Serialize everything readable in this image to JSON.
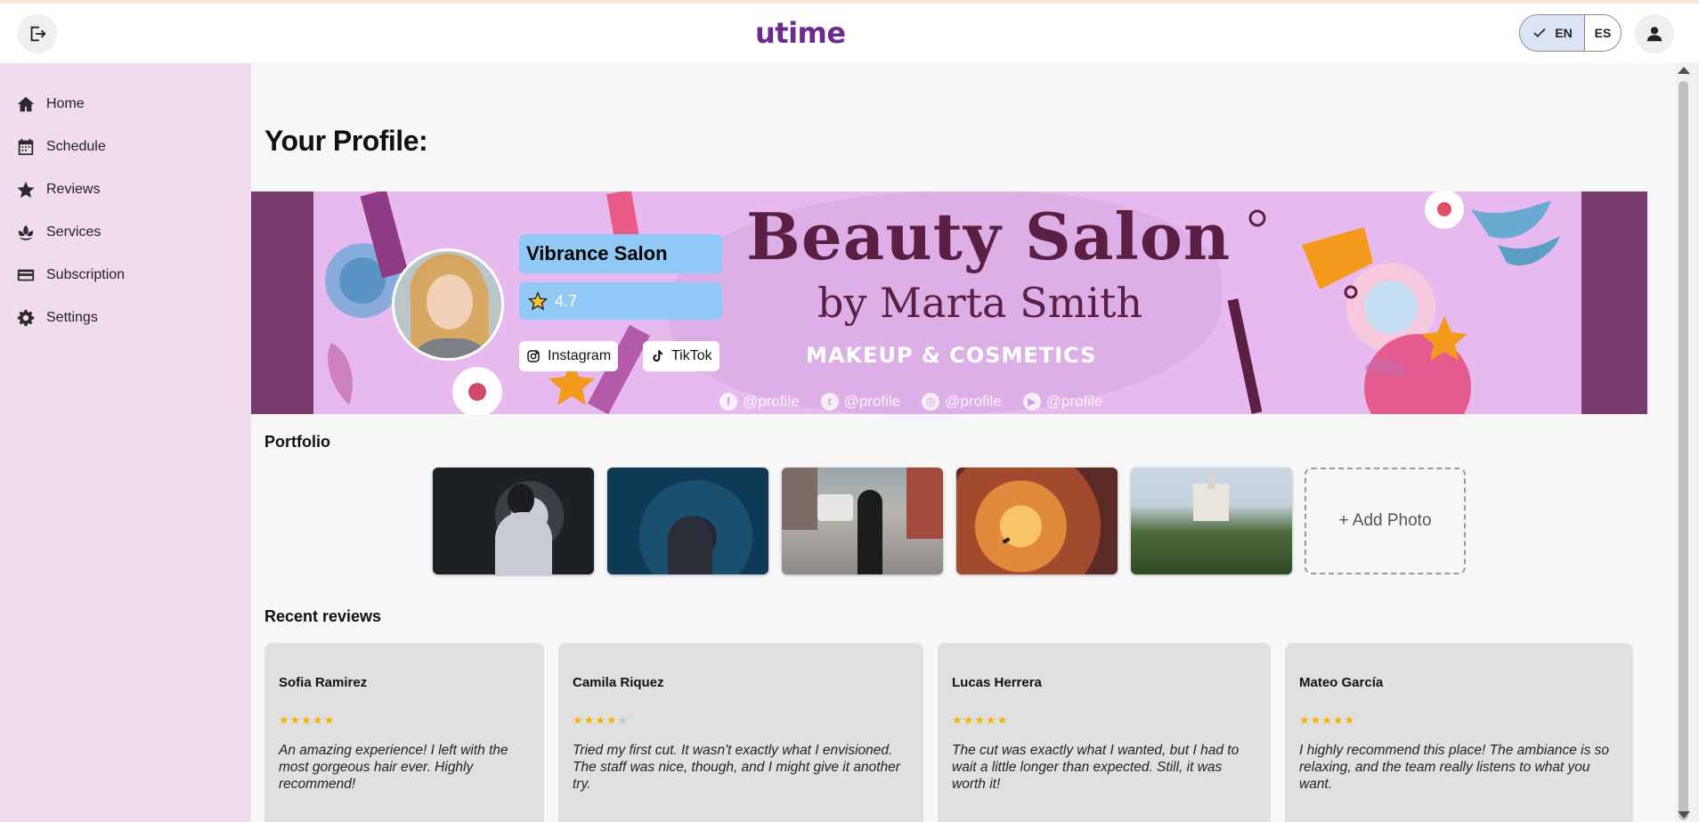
{
  "app": {
    "logo": "utime"
  },
  "header": {
    "lang_en": "EN",
    "lang_es": "ES"
  },
  "sidebar": {
    "items": [
      {
        "label": "Home",
        "icon": "home-icon"
      },
      {
        "label": "Schedule",
        "icon": "calendar-icon"
      },
      {
        "label": "Reviews",
        "icon": "star-icon"
      },
      {
        "label": "Services",
        "icon": "lotus-icon"
      },
      {
        "label": "Subscription",
        "icon": "card-icon"
      },
      {
        "label": "Settings",
        "icon": "gear-icon"
      }
    ]
  },
  "profile": {
    "page_title": "Your Profile:",
    "salon_name": "Vibrance Salon",
    "rating": "4.7",
    "links": {
      "instagram": "Instagram",
      "tiktok": "TikTok"
    },
    "banner": {
      "title": "Beauty Salon",
      "byline": "by Marta Smith",
      "subtitle": "MAKEUP & COSMETICS",
      "handles": [
        "@profile",
        "@profile",
        "@profile",
        "@profile"
      ]
    }
  },
  "portfolio": {
    "title": "Portfolio",
    "add_label": "+ Add Photo"
  },
  "reviews": {
    "title": "Recent reviews",
    "items": [
      {
        "name": "Sofia Ramirez",
        "stars": "★★★★★",
        "stars_off": "",
        "rating": 5,
        "text": "An amazing experience! I left with the most gorgeous hair ever. Highly recommend!"
      },
      {
        "name": "Camila Riquez",
        "stars": "★★★★",
        "stars_off": "★",
        "rating": 4,
        "text": "Tried my first cut. It wasn't exactly what I envisioned. The staff was nice, though, and I might give it another try."
      },
      {
        "name": "Lucas Herrera",
        "stars": "★★★★★",
        "stars_off": "",
        "rating": 5,
        "text": "The cut was exactly what I wanted, but I had to wait a little longer than expected. Still, it was worth it!"
      },
      {
        "name": "Mateo García",
        "stars": "★★★★★",
        "stars_off": "",
        "rating": 5,
        "text": "I highly recommend this place! The ambiance is so relaxing, and the team really listens to what you want."
      }
    ]
  },
  "colors": {
    "sidebar_bg": "#f0dcec",
    "brand": "#6a2a8e",
    "info_box": "#90c8f6",
    "star": "#f5b400"
  }
}
